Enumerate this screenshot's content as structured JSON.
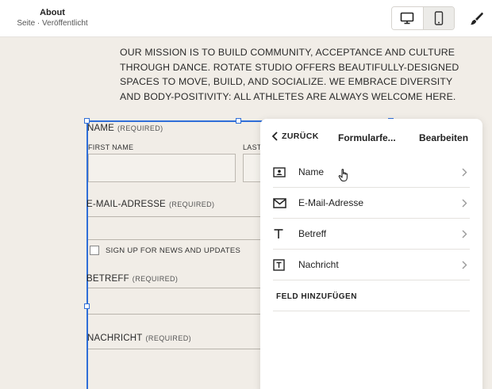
{
  "header": {
    "page_title": "About",
    "page_status": "Seite · Veröffentlicht",
    "devices": [
      {
        "name": "desktop",
        "icon": "monitor-icon",
        "active": true
      },
      {
        "name": "mobile",
        "icon": "phone-icon",
        "active": false
      }
    ],
    "style_icon": "paintbrush-icon"
  },
  "mission": "OUR MISSION IS TO BUILD COMMUNITY, ACCEPTANCE AND CULTURE THROUGH DANCE. ROTATE STUDIO OFFERS BEAUTIFULLY-DESIGNED SPACES TO MOVE, BUILD, AND SOCIALIZE. WE EMBRACE DIVERSITY AND BODY-POSITIVITY: ALL ATHLETES ARE ALWAYS WELCOME HERE.",
  "form": {
    "required": "(REQUIRED)",
    "name_label": "NAME",
    "first_name_label": "FIRST NAME",
    "last_name_label": "LAST",
    "email_label": "E-MAIL-ADRESSE",
    "signup_label": "SIGN UP FOR NEWS AND UPDATES",
    "subject_label": "BETREFF",
    "message_label": "NACHRICHT"
  },
  "panel": {
    "back_label": "ZURÜCK",
    "title": "Formularfe...",
    "edit_label": "Bearbeiten",
    "fields": [
      {
        "label": "Name",
        "icon": "id-card-icon"
      },
      {
        "label": "E-Mail-Adresse",
        "icon": "envelope-icon"
      },
      {
        "label": "Betreff",
        "icon": "text-icon"
      },
      {
        "label": "Nachricht",
        "icon": "text-box-icon"
      }
    ],
    "add_field_label": "FELD HINZUFÜGEN"
  },
  "colors": {
    "selection_blue": "#2f6ed8",
    "canvas_bg": "#f1ede7"
  }
}
